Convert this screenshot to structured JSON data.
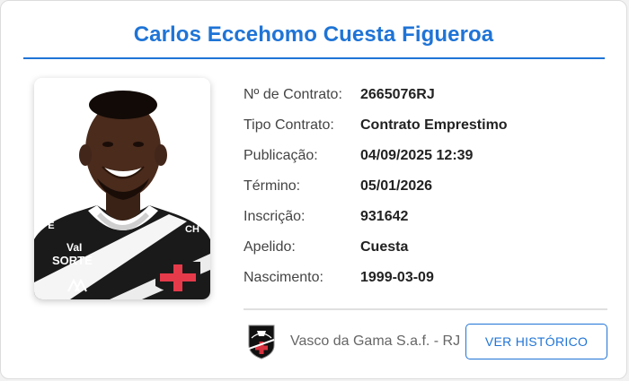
{
  "player": {
    "name": "Carlos Eccehomo Cuesta Figueroa"
  },
  "details": [
    {
      "label": "Nº de Contrato:",
      "value": "2665076RJ"
    },
    {
      "label": "Tipo Contrato:",
      "value": "Contrato Emprestimo"
    },
    {
      "label": "Publicação:",
      "value": "04/09/2025 12:39"
    },
    {
      "label": "Término:",
      "value": "05/01/2026"
    },
    {
      "label": "Inscrição:",
      "value": "931642"
    },
    {
      "label": "Apelido:",
      "value": "Cuesta"
    },
    {
      "label": "Nascimento:",
      "value": "1999-03-09"
    }
  ],
  "club": {
    "name": "Vasco da Gama S.a.f. - RJ",
    "crest_icon": "vasco-crest-icon"
  },
  "actions": {
    "history_label": "VER HISTÓRICO"
  },
  "photo_marks": {
    "sponsor": "SORTE",
    "sponsor_prefix": "VaI",
    "collar_left": "CPE",
    "collar_right": "CH"
  },
  "colors": {
    "accent": "#1f74d6",
    "label": "#444444",
    "value": "#222222",
    "muted": "#666666"
  }
}
